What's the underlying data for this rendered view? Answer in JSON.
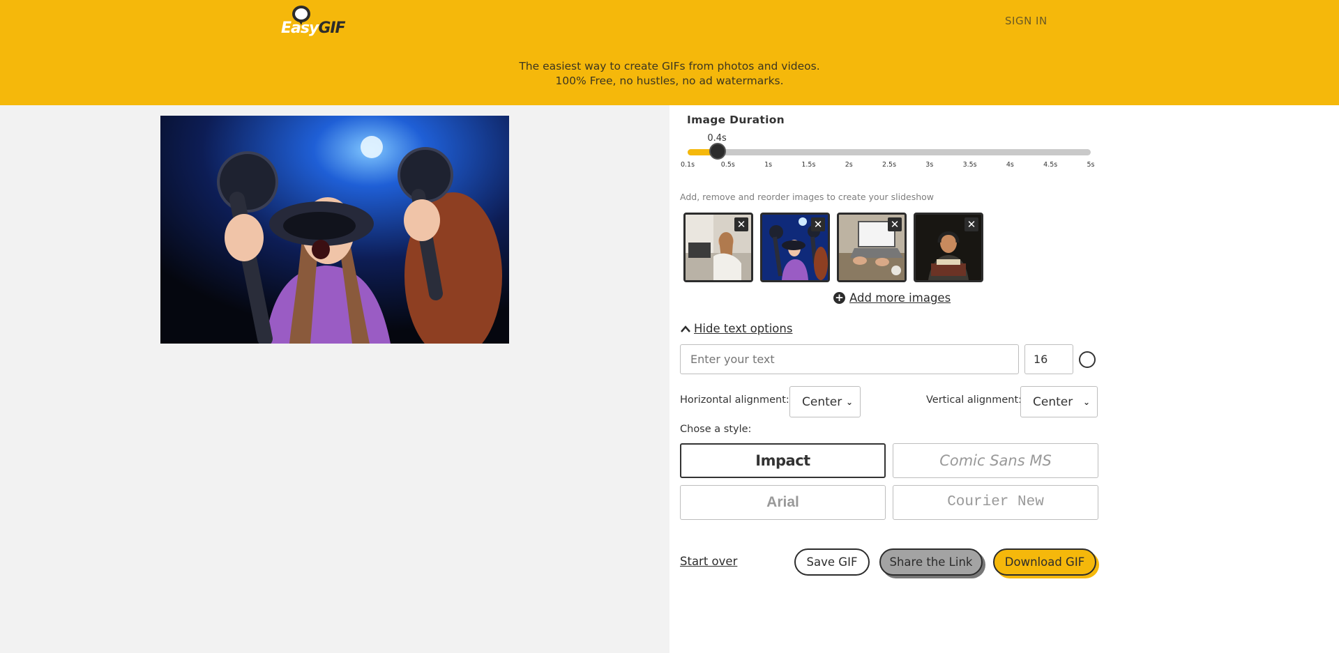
{
  "header": {
    "logo_easy": "Easy",
    "logo_gif": "GIF",
    "sign_in": "SIGN IN",
    "tagline_line1": "The easiest way to create GIFs from photos and videos.",
    "tagline_line2": "100% Free, no hustles, no ad watermarks."
  },
  "colors": {
    "brand_yellow": "#f5b80b",
    "dark": "#2c2c2c"
  },
  "duration": {
    "title": "Image Duration",
    "value_label": "0.4s",
    "value": 0.4,
    "min": 0.1,
    "max": 5,
    "ticks": [
      "0.1s",
      "0.5s",
      "1s",
      "1.5s",
      "2s",
      "2.5s",
      "3s",
      "3.5s",
      "4s",
      "4.5s",
      "5s"
    ]
  },
  "slideshow": {
    "hint": "Add, remove and reorder images to create your slideshow",
    "images": [
      {
        "name": "woman-sofa-laptop"
      },
      {
        "name": "vr-headset-woman"
      },
      {
        "name": "laptop-desk-hands"
      },
      {
        "name": "woman-headphones-night"
      }
    ],
    "remove_glyph": "✕",
    "add_more": "Add more images",
    "add_icon": "+"
  },
  "text_options": {
    "toggle_label": "Hide text options",
    "text_placeholder": "Enter your text",
    "font_size": "16",
    "horizontal_label": "Horizontal alignment:",
    "horizontal_value": "Center",
    "vertical_label": "Vertical alignment:",
    "vertical_value": "Center",
    "style_label": "Chose a style:",
    "styles": [
      "Impact",
      "Comic Sans MS",
      "Arial",
      "Courier New"
    ],
    "selected_style": "Impact"
  },
  "actions": {
    "start_over": "Start over",
    "save_gif": "Save GIF",
    "share_link": "Share the Link",
    "download_gif": "Download GIF"
  }
}
